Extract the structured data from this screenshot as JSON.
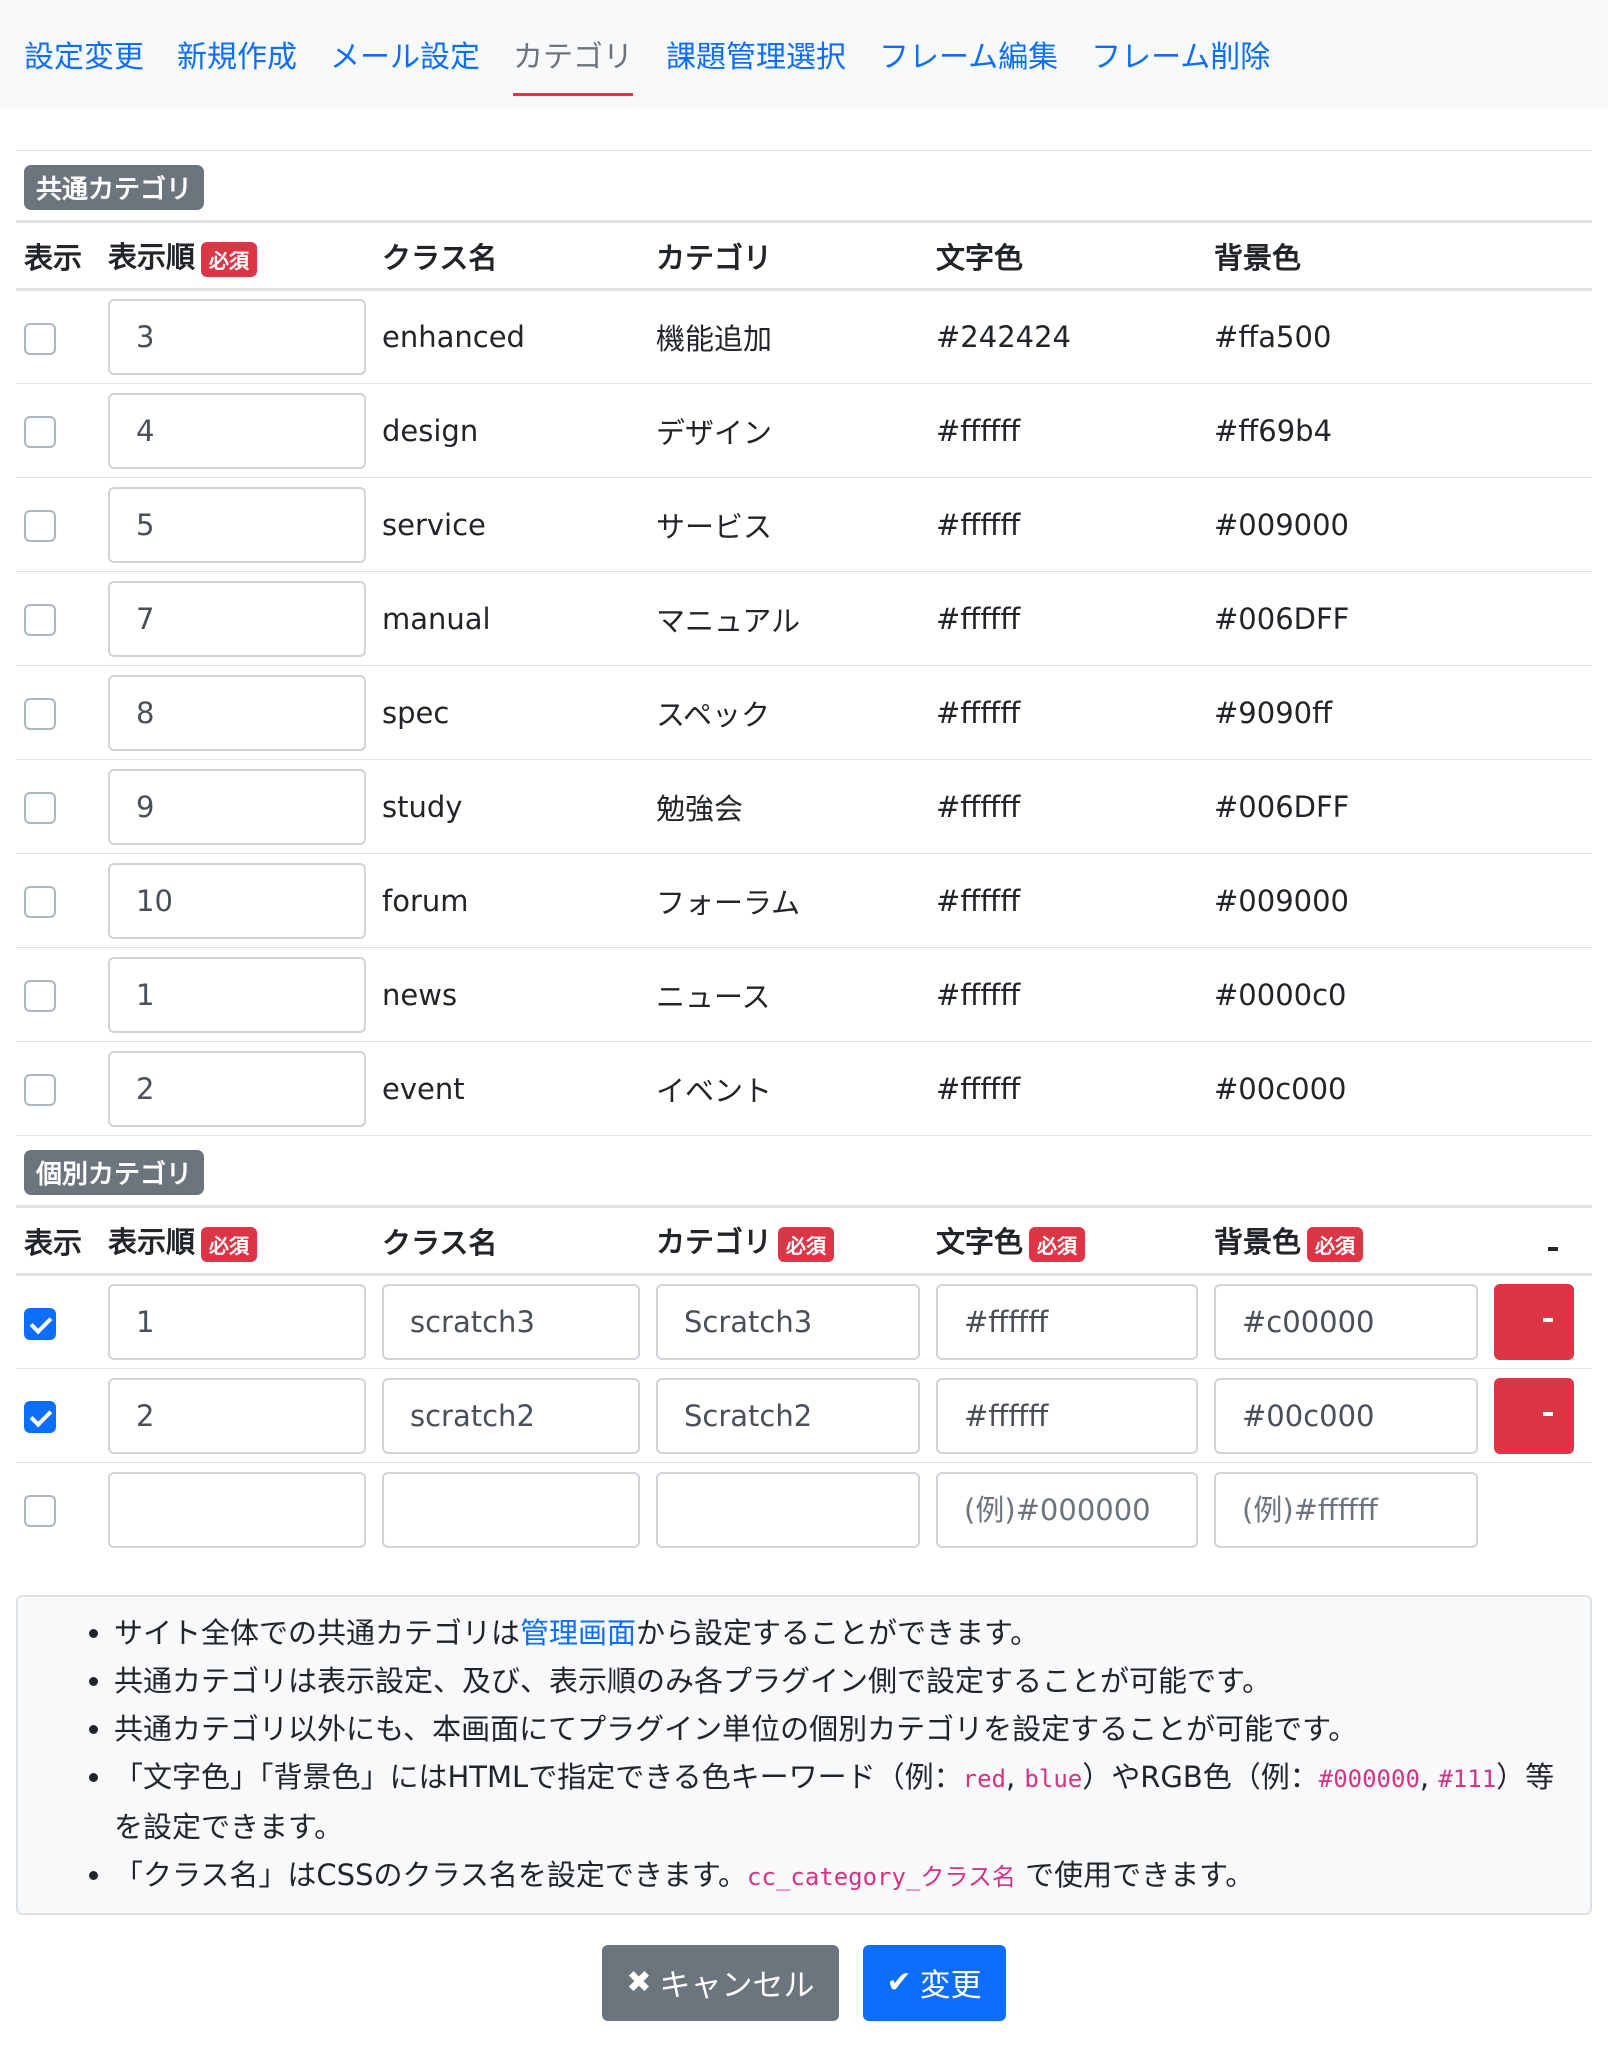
{
  "nav": {
    "tabs": [
      {
        "label": "設定変更"
      },
      {
        "label": "新規作成"
      },
      {
        "label": "メール設定"
      },
      {
        "label": "カテゴリ"
      },
      {
        "label": "課題管理選択"
      },
      {
        "label": "フレーム編集"
      },
      {
        "label": "フレーム削除"
      }
    ],
    "active_index": 3
  },
  "common": {
    "title": "共通カテゴリ",
    "headers": {
      "show": "表示",
      "order": "表示順",
      "class": "クラス名",
      "category": "カテゴリ",
      "text_color": "文字色",
      "bg_color": "背景色"
    },
    "required_label": "必須",
    "rows": [
      {
        "checked": false,
        "order": "3",
        "class": "enhanced",
        "category": "機能追加",
        "text_color": "#242424",
        "bg_color": "#ffa500"
      },
      {
        "checked": false,
        "order": "4",
        "class": "design",
        "category": "デザイン",
        "text_color": "#ffffff",
        "bg_color": "#ff69b4"
      },
      {
        "checked": false,
        "order": "5",
        "class": "service",
        "category": "サービス",
        "text_color": "#ffffff",
        "bg_color": "#009000"
      },
      {
        "checked": false,
        "order": "7",
        "class": "manual",
        "category": "マニュアル",
        "text_color": "#ffffff",
        "bg_color": "#006DFF"
      },
      {
        "checked": false,
        "order": "8",
        "class": "spec",
        "category": "スペック",
        "text_color": "#ffffff",
        "bg_color": "#9090ff"
      },
      {
        "checked": false,
        "order": "9",
        "class": "study",
        "category": "勉強会",
        "text_color": "#ffffff",
        "bg_color": "#006DFF"
      },
      {
        "checked": false,
        "order": "10",
        "class": "forum",
        "category": "フォーラム",
        "text_color": "#ffffff",
        "bg_color": "#009000"
      },
      {
        "checked": false,
        "order": "1",
        "class": "news",
        "category": "ニュース",
        "text_color": "#ffffff",
        "bg_color": "#0000c0"
      },
      {
        "checked": false,
        "order": "2",
        "class": "event",
        "category": "イベント",
        "text_color": "#ffffff",
        "bg_color": "#00c000"
      }
    ]
  },
  "individual": {
    "title": "個別カテゴリ",
    "headers": {
      "show": "表示",
      "order": "表示順",
      "class": "クラス名",
      "category": "カテゴリ",
      "text_color": "文字色",
      "bg_color": "背景色"
    },
    "delete_header_icon": "trash-icon",
    "rows": [
      {
        "checked": true,
        "order": "1",
        "class": "scratch3",
        "category": "Scratch3",
        "text_color": "#ffffff",
        "bg_color": "#c00000"
      },
      {
        "checked": true,
        "order": "2",
        "class": "scratch2",
        "category": "Scratch2",
        "text_color": "#ffffff",
        "bg_color": "#00c000"
      }
    ],
    "new_row": {
      "text_color_placeholder": "(例)#000000",
      "bg_color_placeholder": "(例)#ffffff"
    }
  },
  "notes": {
    "n1_pre": "サイト全体での共通カテゴリは",
    "n1_link": "管理画面",
    "n1_post": "から設定することができます。",
    "n2": "共通カテゴリは表示設定、及び、表示順のみ各プラグイン側で設定することが可能です。",
    "n3": "共通カテゴリ以外にも、本画面にてプラグイン単位の個別カテゴリを設定することが可能です。",
    "n4_a": "「文字色」「背景色」にはHTMLで指定できる色キーワード（例：",
    "n4_code1": "red",
    "n4_sep": ", ",
    "n4_code2": "blue",
    "n4_b": "）やRGB色（例：",
    "n4_code3": "#000000",
    "n4_sep2": ", ",
    "n4_code4": "#111",
    "n4_c": "）等を設定できます。",
    "n5_a": "「クラス名」はCSSのクラス名を設定できます。",
    "n5_code": "cc_category_クラス名",
    "n5_b": " で使用できます。"
  },
  "buttons": {
    "cancel": "キャンセル",
    "submit": "変更"
  },
  "colors": {
    "primary": "#0d6efd",
    "danger": "#dc3545",
    "secondary": "#6c757d"
  }
}
